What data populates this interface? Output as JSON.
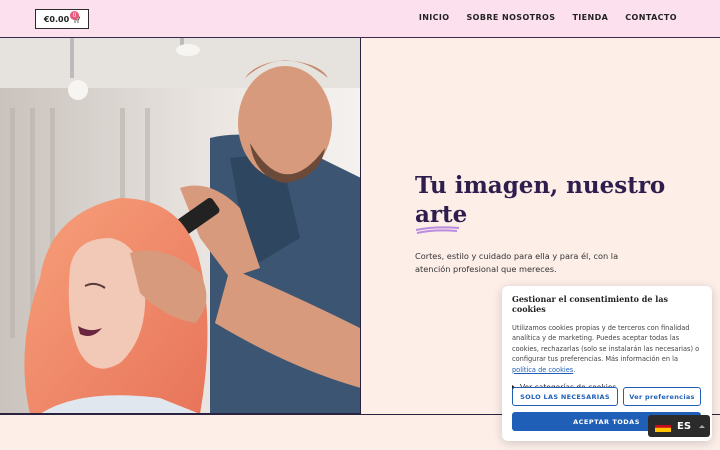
{
  "header": {
    "cart_price": "€0.00",
    "cart_count": "0",
    "cart_icon": "cart-icon",
    "nav": [
      {
        "label": "INICIO"
      },
      {
        "label": "SOBRE NOSOTROS"
      },
      {
        "label": "TIENDA"
      },
      {
        "label": "CONTACTO"
      }
    ]
  },
  "hero": {
    "title_line1": "Tu imagen, nuestro",
    "title_line2": "arte",
    "subtitle": "Cortes, estilo y cuidado para ella y para él, con la atención profesional que mereces.",
    "photo": "hairdresser-styling-client-photo"
  },
  "cookie": {
    "title": "Gestionar el consentimiento de las cookies",
    "body": "Utilizamos cookies propias y de terceros con finalidad analítica y de marketing. Puedes aceptar todas las cookies, rechazarlas (solo se instalarán las necesarias) o configurar tus preferencias. Más información en la",
    "link": "política de cookies",
    "link_suffix": ".",
    "categories_toggle": "Ver categorías de cookies",
    "btn_necessary": "SOLO LAS NECESARIAS",
    "btn_preferences": "Ver preferencias",
    "btn_accept": "ACEPTAR TODAS"
  },
  "language": {
    "code": "ES",
    "flag_icon": "spain-flag-icon"
  },
  "colors": {
    "header_bg": "#fde0ee",
    "page_bg": "#fdeee8",
    "title": "#2e1d4d",
    "accent_blue": "#1f5fb8",
    "underline": "#b98ce0"
  }
}
